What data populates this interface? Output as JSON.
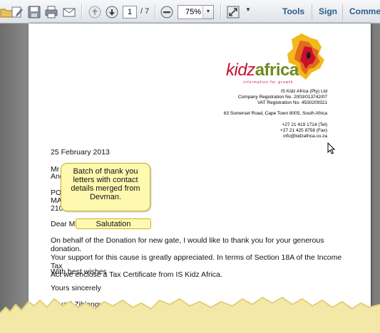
{
  "toolbar": {
    "page_current": "1",
    "page_total": "/ 7",
    "zoom": "75%",
    "menu": {
      "tools": "Tools",
      "sign": "Sign",
      "comment": "Comment"
    }
  },
  "letterhead": {
    "brand_kidz": "kidz",
    "brand_africa": "africa",
    "tagline": "information for growth",
    "company": "IS Kidz Africa (Pty) Ltd",
    "company_reg": "Company Registration No. 2003/013742/07",
    "vat_reg": "VAT Registration No. 4530209321",
    "address": "63 Somerset Road, Cape Town 8005, South Africa",
    "tel": "+27 21 419 1714 (Tel)",
    "fax": "+27 21 425 8758 (Fax)",
    "email": "info@kidzafrica.co.za"
  },
  "letter": {
    "date": "25 February 2013",
    "addr1": "Mr N",
    "addr2": "Ang",
    "addr3": "PO",
    "addr4": "MA",
    "addr5": "210",
    "dear": "Dear Mr",
    "para1_l1": "On behalf of the Donation for new gate, I would like to thank you for your generous donation.",
    "para1_l2": "Your support for this cause is greatly appreciated. In terms of Section 18A of the Income Tax",
    "para1_l3": "Act we enclose a Tax Certificate from IS Kidz Africa.",
    "wishes": "With best wishes",
    "sincerely": "Yours sincerely",
    "signatory": "Zsuzsi Zihlangu"
  },
  "callout": {
    "line1": "Batch of thank you",
    "line2": "letters with contact",
    "line3": "details merged from",
    "line4": "Devman."
  },
  "merge_field": {
    "salutation": "Salutation"
  },
  "icons": [
    "open-folder-icon",
    "edit-icon",
    "save-icon",
    "print-icon",
    "email-icon",
    "page-up-icon",
    "page-down-icon",
    "zoom-out-icon",
    "fit-page-icon",
    "more-icon",
    "cursor-icon"
  ]
}
